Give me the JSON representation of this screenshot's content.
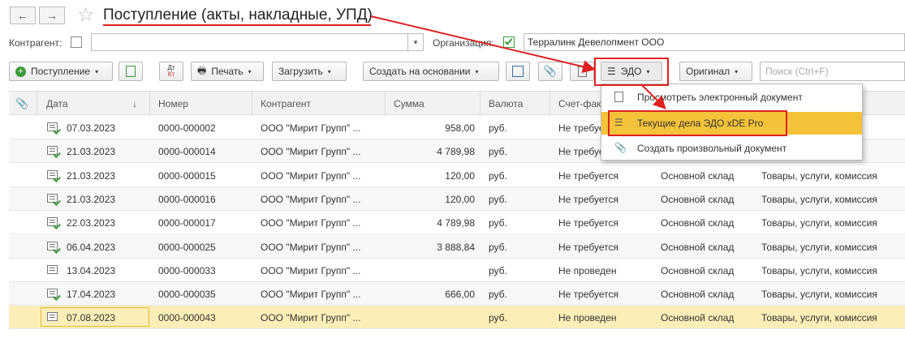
{
  "header": {
    "back": "←",
    "forward": "→",
    "star": "☆",
    "title": "Поступление (акты, накладные, УПД)"
  },
  "filters": {
    "counterparty_label": "Контрагент:",
    "counterparty_value": "",
    "org_label": "Организация:",
    "org_value": "Терралинк Девелопмент ООО"
  },
  "toolbar": {
    "receipt": "Поступление",
    "dtkt_top": "Дт",
    "dtkt_bottom": "Кт",
    "print": "Печать",
    "load": "Загрузить",
    "create_based": "Создать на основании",
    "edo": "ЭДО",
    "original": "Оригинал",
    "search_placeholder": "Поиск (Ctrl+F)"
  },
  "columns": [
    "Дата",
    "Номер",
    "Контрагент",
    "Сумма",
    "Валюта",
    "Счет-фак"
  ],
  "rows": [
    {
      "date": "07.03.2023",
      "number": "0000-000002",
      "partner": "ООО \"Мирит Групп\" ...",
      "sum": "958,00",
      "cur": "руб.",
      "invoice": "Не требуется",
      "warehouse": "",
      "type": "",
      "ok": true
    },
    {
      "date": "21.03.2023",
      "number": "0000-000014",
      "partner": "ООО \"Мирит Групп\" ...",
      "sum": "4 789,98",
      "cur": "руб.",
      "invoice": "Не требуется",
      "warehouse": "",
      "type": "",
      "ok": true
    },
    {
      "date": "21.03.2023",
      "number": "0000-000015",
      "partner": "ООО \"Мирит Групп\" ...",
      "sum": "120,00",
      "cur": "руб.",
      "invoice": "Не требуется",
      "warehouse": "Основной склад",
      "type": "Товары, услуги, комиссия",
      "ok": true
    },
    {
      "date": "21.03.2023",
      "number": "0000-000016",
      "partner": "ООО \"Мирит Групп\" ...",
      "sum": "120,00",
      "cur": "руб.",
      "invoice": "Не требуется",
      "warehouse": "Основной склад",
      "type": "Товары, услуги, комиссия",
      "ok": true
    },
    {
      "date": "22.03.2023",
      "number": "0000-000017",
      "partner": "ООО \"Мирит Групп\" ...",
      "sum": "4 789,98",
      "cur": "руб.",
      "invoice": "Не требуется",
      "warehouse": "Основной склад",
      "type": "Товары, услуги, комиссия",
      "ok": true
    },
    {
      "date": "06.04.2023",
      "number": "0000-000025",
      "partner": "ООО \"Мирит Групп\" ...",
      "sum": "3 888,84",
      "cur": "руб.",
      "invoice": "Не требуется",
      "warehouse": "Основной склад",
      "type": "Товары, услуги, комиссия",
      "ok": true
    },
    {
      "date": "13.04.2023",
      "number": "0000-000033",
      "partner": "ООО \"Мирит Групп\" ...",
      "sum": "",
      "cur": "руб.",
      "invoice": "Не проведен",
      "warehouse": "Основной склад",
      "type": "Товары, услуги, комиссия",
      "ok": false
    },
    {
      "date": "17.04.2023",
      "number": "0000-000035",
      "partner": "ООО \"Мирит Групп\" ...",
      "sum": "666,00",
      "cur": "руб.",
      "invoice": "Не требуется",
      "warehouse": "Основной склад",
      "type": "Товары, услуги, комиссия",
      "ok": true
    },
    {
      "date": "07.08.2023",
      "number": "0000-000043",
      "partner": "ООО \"Мирит Групп\" ...",
      "sum": "",
      "cur": "руб.",
      "invoice": "Не проведен",
      "warehouse": "Основной склад",
      "type": "Товары, услуги, комиссия",
      "ok": false
    }
  ],
  "edo_menu": {
    "items": [
      "Просмотреть электронный документ",
      "Текущие дела ЭДО xDE Pro",
      "Создать произвольный документ"
    ]
  },
  "colors": {
    "highlight": "#f5c33a",
    "selected_row": "#fbeeb8",
    "annotation": "#e02020"
  }
}
